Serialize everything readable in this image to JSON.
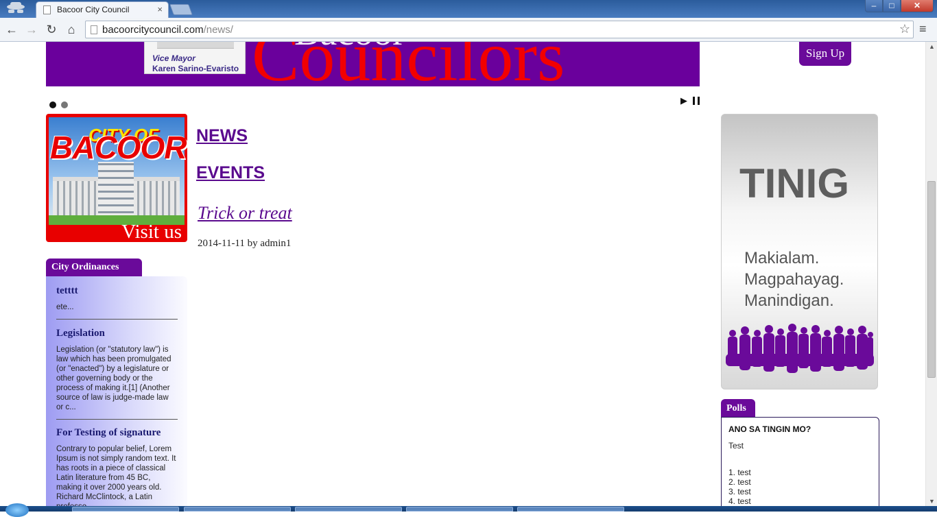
{
  "browser": {
    "tab_title": "Bacoor City Council",
    "tab_close": "×",
    "url_domain": "bacoorcitycouncil.com",
    "url_path": "/news/",
    "star": "☆",
    "menu": "≡",
    "back": "←",
    "forward": "→",
    "reload": "↻",
    "home": "⌂",
    "win_min": "–",
    "win_max": "□",
    "win_close": "✕"
  },
  "banner": {
    "vm_title": "Vice Mayor",
    "vm_name": "Karen Sarino-Evaristo",
    "heading": "Councilors",
    "heading_partial": "Bacoor"
  },
  "header": {
    "signup_label": "Sign Up"
  },
  "slider": {
    "play": "▶"
  },
  "promo": {
    "city_of": "CITY OF",
    "bacoor": "BACOOR",
    "visit": "Visit us"
  },
  "main": {
    "news_label": "NEWS",
    "events_label": "EVENTS",
    "post": {
      "title": "Trick or treat",
      "meta": "2014-11-11 by admin1"
    }
  },
  "ordinances": {
    "heading": "City Ordinances",
    "items": [
      {
        "title": "tetttt",
        "text": "ete..."
      },
      {
        "title": "Legislation",
        "text": "Legislation (or \"statutory law\") is law which has been promulgated (or \"enacted\") by a legislature or other governing body or the process of making it.[1] (Another source of law is judge-made law or c..."
      },
      {
        "title": "For Testing of signature",
        "text": "Contrary to popular belief, Lorem Ipsum is not simply random text. It has roots in a piece of classical Latin literature from 45 BC, making it over 2000 years old. Richard McClintock, a Latin professo..."
      }
    ]
  },
  "tinig": {
    "title": "TINIG",
    "lines": [
      "Makialam.",
      "Magpahayag.",
      "Manindigan."
    ]
  },
  "polls": {
    "heading": "Polls",
    "question": "ANO SA TINGIN MO?",
    "description": "Test",
    "options": [
      "1. test",
      "2. test",
      "3. test",
      "4. test"
    ]
  },
  "colors": {
    "brand_purple": "#6a0a9a",
    "banner_red": "#f20000",
    "link_purple": "#5a0a8e"
  }
}
